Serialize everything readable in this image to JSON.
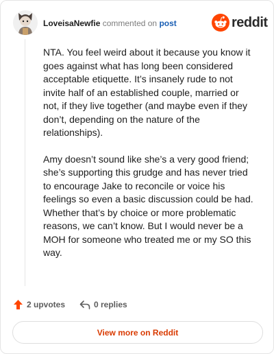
{
  "header": {
    "author": "LoveisaNewfie",
    "commented_text": "commented on",
    "post_link": "post",
    "brand": "reddit"
  },
  "comment": {
    "paragraphs": [
      "NTA. You feel weird about it because you know it goes against what has long been considered acceptable etiquette. It’s insanely rude to not invite half of an established couple, married or not, if they live together (and maybe even if they don’t, depending on the nature of the relationships).",
      "Amy doesn’t sound like she’s a very good friend; she’s supporting this grudge and has never tried to encourage Jake to reconcile or voice his feelings so even a basic discussion could be had. Whether that’s by choice or more problematic reasons, we can’t know. But I would never be a MOH for someone who treated me or my SO this way."
    ]
  },
  "actions": {
    "upvotes": "2 upvotes",
    "replies": "0 replies",
    "view_more": "View more on Reddit"
  },
  "colors": {
    "accent": "#ff4500",
    "link": "#1a5fb4",
    "view_more_text": "#d93a00"
  },
  "icons": [
    "avatar",
    "reddit-logo-icon",
    "upvote-arrow-icon",
    "reply-arrow-icon"
  ]
}
